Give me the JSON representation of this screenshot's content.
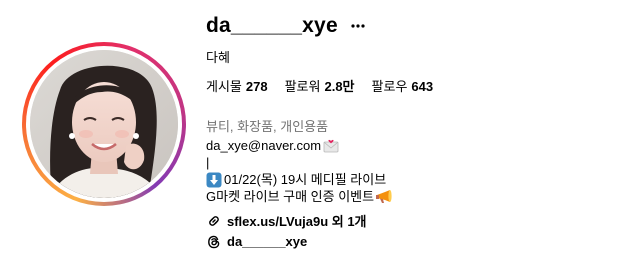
{
  "profile": {
    "username": "da______xye",
    "full_name": "다혜",
    "stats": [
      {
        "label": "게시물",
        "value": "278"
      },
      {
        "label": "팔로워",
        "value": "2.8만"
      },
      {
        "label": "팔로우",
        "value": "643"
      }
    ],
    "category": "뷰티, 화장품, 개인용품",
    "bio": {
      "line1": "da_xye@naver.com",
      "line1_icon": "envelope-with-heart-icon",
      "line2": "|",
      "line3": "01/22(목) 19시 메디필 라이브",
      "line3_icon": "down-arrow-emoji-icon",
      "line4": "G마켓 라이브 구매 인증 이벤트",
      "line4_icon": "megaphone-icon"
    },
    "link": {
      "text": "sflex.us/LVuja9u 외 1개",
      "icon": "link-icon"
    },
    "threads": {
      "text": "da______xye",
      "icon": "threads-icon"
    }
  },
  "colors": {
    "ring_gradient": [
      "#fcb045",
      "#f77737",
      "#fd1d1d",
      "#e1306c",
      "#c13584",
      "#833ab4"
    ],
    "secondary_text": "#737373",
    "primary_text": "#000000",
    "down_arrow_emoji_bg": "#3b88c3"
  }
}
